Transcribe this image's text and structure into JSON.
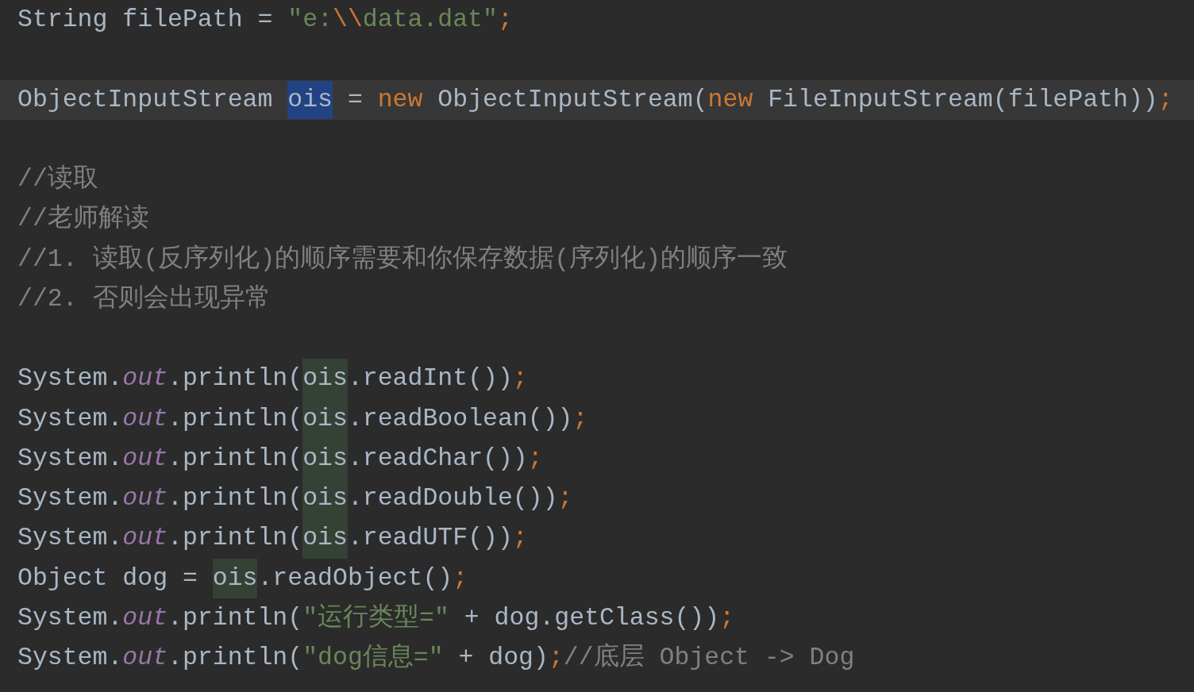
{
  "editor": {
    "lines": [
      {
        "kind": "code",
        "current": false,
        "tokens": [
          {
            "text": "String filePath = ",
            "kind": "plain"
          },
          {
            "text": "\"e:",
            "kind": "string"
          },
          {
            "text": "\\\\",
            "kind": "escape"
          },
          {
            "text": "data.dat\"",
            "kind": "string"
          },
          {
            "text": ";",
            "kind": "punct"
          }
        ]
      },
      {
        "kind": "blank",
        "current": false
      },
      {
        "kind": "code",
        "current": true,
        "tokens": [
          {
            "text": "ObjectInputStream ",
            "kind": "plain"
          },
          {
            "text": "ois",
            "kind": "selected"
          },
          {
            "text": " = ",
            "kind": "plain"
          },
          {
            "text": "new",
            "kind": "keyword"
          },
          {
            "text": " ObjectInputStream(",
            "kind": "plain"
          },
          {
            "text": "new",
            "kind": "keyword"
          },
          {
            "text": " FileInputStream(filePath))",
            "kind": "plain"
          },
          {
            "text": ";",
            "kind": "punct"
          }
        ]
      },
      {
        "kind": "blank",
        "current": false
      },
      {
        "kind": "code",
        "current": false,
        "tokens": [
          {
            "text": "//读取",
            "kind": "comment"
          }
        ]
      },
      {
        "kind": "code",
        "current": false,
        "tokens": [
          {
            "text": "//老师解读",
            "kind": "comment"
          }
        ]
      },
      {
        "kind": "code",
        "current": false,
        "tokens": [
          {
            "text": "//1. 读取(反序列化)的顺序需要和你保存数据(序列化)的顺序一致",
            "kind": "comment"
          }
        ]
      },
      {
        "kind": "code",
        "current": false,
        "tokens": [
          {
            "text": "//2. 否则会出现异常",
            "kind": "comment"
          }
        ]
      },
      {
        "kind": "blank",
        "current": false
      },
      {
        "kind": "code",
        "current": false,
        "tokens": [
          {
            "text": "System.",
            "kind": "plain"
          },
          {
            "text": "out",
            "kind": "field"
          },
          {
            "text": ".println(",
            "kind": "plain"
          },
          {
            "text": "ois",
            "kind": "usage"
          },
          {
            "text": ".readInt())",
            "kind": "plain"
          },
          {
            "text": ";",
            "kind": "punct"
          }
        ]
      },
      {
        "kind": "code",
        "current": false,
        "tokens": [
          {
            "text": "System.",
            "kind": "plain"
          },
          {
            "text": "out",
            "kind": "field"
          },
          {
            "text": ".println(",
            "kind": "plain"
          },
          {
            "text": "ois",
            "kind": "usage"
          },
          {
            "text": ".readBoolean())",
            "kind": "plain"
          },
          {
            "text": ";",
            "kind": "punct"
          }
        ]
      },
      {
        "kind": "code",
        "current": false,
        "tokens": [
          {
            "text": "System.",
            "kind": "plain"
          },
          {
            "text": "out",
            "kind": "field"
          },
          {
            "text": ".println(",
            "kind": "plain"
          },
          {
            "text": "ois",
            "kind": "usage"
          },
          {
            "text": ".readChar())",
            "kind": "plain"
          },
          {
            "text": ";",
            "kind": "punct"
          }
        ]
      },
      {
        "kind": "code",
        "current": false,
        "tokens": [
          {
            "text": "System.",
            "kind": "plain"
          },
          {
            "text": "out",
            "kind": "field"
          },
          {
            "text": ".println(",
            "kind": "plain"
          },
          {
            "text": "ois",
            "kind": "usage"
          },
          {
            "text": ".readDouble())",
            "kind": "plain"
          },
          {
            "text": ";",
            "kind": "punct"
          }
        ]
      },
      {
        "kind": "code",
        "current": false,
        "tokens": [
          {
            "text": "System.",
            "kind": "plain"
          },
          {
            "text": "out",
            "kind": "field"
          },
          {
            "text": ".println(",
            "kind": "plain"
          },
          {
            "text": "ois",
            "kind": "usage"
          },
          {
            "text": ".readUTF())",
            "kind": "plain"
          },
          {
            "text": ";",
            "kind": "punct"
          }
        ]
      },
      {
        "kind": "code",
        "current": false,
        "tokens": [
          {
            "text": "Object dog = ",
            "kind": "plain"
          },
          {
            "text": "ois",
            "kind": "usage"
          },
          {
            "text": ".readObject()",
            "kind": "plain"
          },
          {
            "text": ";",
            "kind": "punct"
          }
        ]
      },
      {
        "kind": "code",
        "current": false,
        "tokens": [
          {
            "text": "System.",
            "kind": "plain"
          },
          {
            "text": "out",
            "kind": "field"
          },
          {
            "text": ".println(",
            "kind": "plain"
          },
          {
            "text": "\"运行类型=\"",
            "kind": "string"
          },
          {
            "text": " + dog.getClass())",
            "kind": "plain"
          },
          {
            "text": ";",
            "kind": "punct"
          }
        ]
      },
      {
        "kind": "code",
        "current": false,
        "tokens": [
          {
            "text": "System.",
            "kind": "plain"
          },
          {
            "text": "out",
            "kind": "field"
          },
          {
            "text": ".println(",
            "kind": "plain"
          },
          {
            "text": "\"dog信息=\"",
            "kind": "string"
          },
          {
            "text": " + dog)",
            "kind": "plain"
          },
          {
            "text": ";",
            "kind": "punct"
          },
          {
            "text": "//底层 Object -> Dog",
            "kind": "comment"
          }
        ]
      }
    ]
  }
}
